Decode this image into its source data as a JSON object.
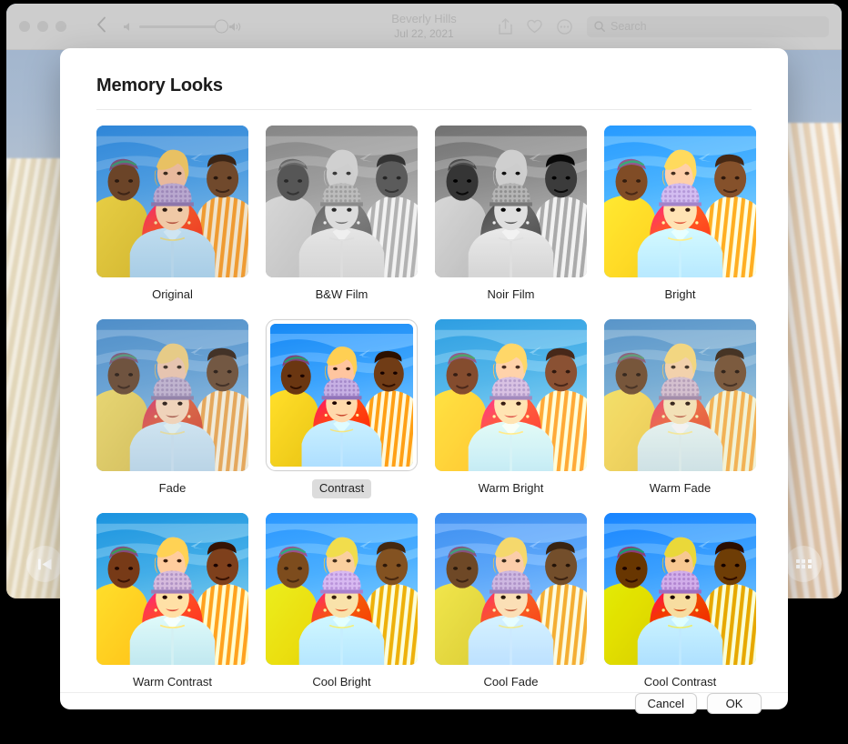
{
  "window": {
    "title": "Beverly Hills",
    "subtitle": "Jul 22, 2021",
    "back_icon": "chevron-left-icon",
    "volume_low_icon": "speaker-low-icon",
    "volume_high_icon": "speaker-high-icon",
    "share_icon": "share-icon",
    "favorite_icon": "heart-icon",
    "more_icon": "more-circle-icon",
    "search_icon": "search-icon",
    "search_placeholder": "Search",
    "search_value": "",
    "previous_icon": "skip-back-icon",
    "grid_icon": "grid-icon"
  },
  "dialog": {
    "title": "Memory Looks",
    "selected_look": "Contrast",
    "looks": [
      {
        "label": "Original",
        "filter": "f-original"
      },
      {
        "label": "B&W Film",
        "filter": "f-bwfilm"
      },
      {
        "label": "Noir Film",
        "filter": "f-noirfilm"
      },
      {
        "label": "Bright",
        "filter": "f-bright"
      },
      {
        "label": "Fade",
        "filter": "f-fade"
      },
      {
        "label": "Contrast",
        "filter": "f-contrast"
      },
      {
        "label": "Warm Bright",
        "filter": "f-warmbright"
      },
      {
        "label": "Warm Fade",
        "filter": "f-warmfade"
      },
      {
        "label": "Warm Contrast",
        "filter": "f-warmcontrast"
      },
      {
        "label": "Cool Bright",
        "filter": "f-coolbright"
      },
      {
        "label": "Cool Fade",
        "filter": "f-coolfade"
      },
      {
        "label": "Cool Contrast",
        "filter": "f-coolcontrast"
      }
    ],
    "buttons": {
      "cancel": "Cancel",
      "ok": "OK"
    }
  },
  "colors": {
    "sky": "#4a90d9",
    "selection_chip": "#dcdcdc",
    "toolbar": "#cdcdcd"
  }
}
